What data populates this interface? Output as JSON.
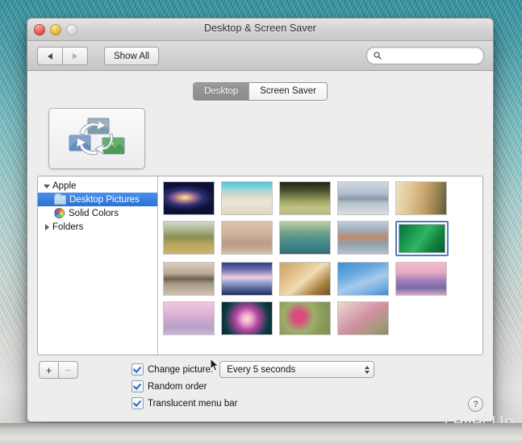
{
  "window": {
    "title": "Desktop & Screen Saver",
    "traffic_lights": [
      "close",
      "minimize",
      "zoom"
    ]
  },
  "toolbar": {
    "back_label": "◀",
    "forward_label": "▶",
    "show_all_label": "Show All",
    "search_placeholder": "",
    "search_value": "",
    "search_icon": "search-icon"
  },
  "tabs": [
    {
      "label": "Desktop",
      "selected": true
    },
    {
      "label": "Screen Saver",
      "selected": false
    }
  ],
  "preview": {
    "icon": "rotating-desktop-pictures-icon",
    "description": "Three pictures with circular rotation arrows"
  },
  "sidebar": {
    "items": [
      {
        "label": "Apple",
        "level": 0,
        "disclosure": "open",
        "icon": "none",
        "selected": false
      },
      {
        "label": "Desktop Pictures",
        "level": 1,
        "disclosure": "none",
        "icon": "folder-icon",
        "selected": true
      },
      {
        "label": "Solid Colors",
        "level": 1,
        "disclosure": "none",
        "icon": "color-wheel-icon",
        "selected": false
      },
      {
        "label": "Folders",
        "level": 0,
        "disclosure": "closed",
        "icon": "none",
        "selected": false
      }
    ]
  },
  "grid": {
    "rows": [
      [
        {
          "name": "andromeda-galaxy",
          "selected": false
        },
        {
          "name": "beach-shoreline",
          "selected": false
        },
        {
          "name": "tall-grass",
          "selected": false
        },
        {
          "name": "misty-lake",
          "selected": false
        },
        {
          "name": "desert-dune-bird",
          "selected": false
        }
      ],
      [
        {
          "name": "elephant-savanna",
          "selected": false
        },
        {
          "name": "desert-caravan",
          "selected": false
        },
        {
          "name": "lily-pads",
          "selected": false
        },
        {
          "name": "abstract-landscape",
          "selected": false
        },
        {
          "name": "green-eelgrass",
          "selected": true
        }
      ],
      [
        {
          "name": "island-reflection",
          "selected": false
        },
        {
          "name": "mountain-lake-sunset",
          "selected": false
        },
        {
          "name": "lion-portrait",
          "selected": false
        },
        {
          "name": "blue-sky-crescent-moon",
          "selected": false
        },
        {
          "name": "pink-mount-fuji",
          "selected": false
        }
      ],
      [
        {
          "name": "pink-mist-hills",
          "selected": false
        },
        {
          "name": "purple-lotus",
          "selected": false
        },
        {
          "name": "pink-poppies",
          "selected": false
        },
        {
          "name": "pink-berries",
          "selected": false
        }
      ]
    ]
  },
  "controls": {
    "add_label": "+",
    "remove_label": "−",
    "change_picture": {
      "label": "Change picture:",
      "checked": true
    },
    "interval": {
      "value": "Every 5 seconds"
    },
    "random_order": {
      "label": "Random order",
      "checked": true
    },
    "translucent_menu_bar": {
      "label": "Translucent menu bar",
      "checked": true
    },
    "help_label": "?"
  },
  "watermark": {
    "text": "Level Up"
  },
  "colors": {
    "selection_blue": "#2b70d6",
    "thumb_selection_border": "#4f7ec0",
    "window_chrome": "#d3d3d3",
    "desktop_teal": "#79bfc4"
  }
}
